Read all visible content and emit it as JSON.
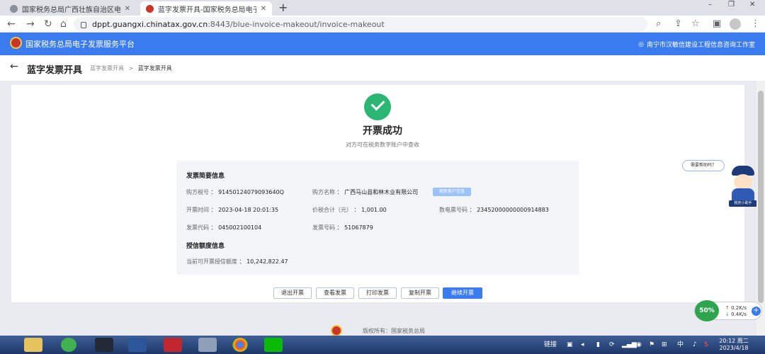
{
  "browser": {
    "tabs": [
      {
        "title": "国家税务总局广西壮族自治区电子",
        "active": false,
        "icon": "globe-icon"
      },
      {
        "title": "蓝字发票开具-国家税务总局电子",
        "active": true,
        "icon": "tax-emblem-icon"
      }
    ],
    "new_tab_symbol": "+",
    "window_controls": [
      "–",
      "❐",
      "✕"
    ],
    "url_host": "dppt.guangxi.chinatax.gov.cn",
    "url_rest": ":8443/blue-invoice-makeout/invoice-makeout"
  },
  "site": {
    "title": "国家税务总局电子发票服务平台",
    "user": "南宁市汉敏信建设工程信息咨询工作室",
    "brand_color": "#3a7bf0"
  },
  "page": {
    "title": "蓝字发票开具",
    "breadcrumb": [
      "蓝字发票开具",
      "蓝字发票开具"
    ],
    "breadcrumb_sep": ">"
  },
  "result": {
    "title": "开票成功",
    "subtitle": "对方可在税务数字账户中查收",
    "status_color": "#2bb673"
  },
  "summary": {
    "heading": "发票简要信息",
    "buyer_tax_no_label": "购方税号",
    "buyer_tax_no": "91450124079093640Q",
    "buyer_name_label": "购方名称",
    "buyer_name": "广西马山县和林木业有限公司",
    "buyer_tag": "更新客户信息",
    "issue_time_label": "开票时间",
    "issue_time": "2023-04-18 20:01:35",
    "total_label": "价税合计（元）",
    "total": "1,001.00",
    "einvoice_no_label": "数电票号码",
    "einvoice_no": "23452000000000914883",
    "invoice_code_label": "发票代码",
    "invoice_code": "045002100104",
    "invoice_no_label": "发票号码",
    "invoice_no": "51067879"
  },
  "credit": {
    "heading": "授信额度信息",
    "label": "当前可开票授信额度",
    "value": "10,242,822.47"
  },
  "actions": [
    "退出开票",
    "查看发票",
    "打印发票",
    "复制开票",
    "继续开票"
  ],
  "helper": {
    "bubble": "需要帮助吗？",
    "mascot_label": "税务小助手"
  },
  "footer": {
    "copyright": "版权所有：国家税务总局"
  },
  "speed": {
    "percent": "50%",
    "up": "0.2K/s",
    "down": "0.4K/s"
  },
  "taskbar": {
    "tray_label": "链接",
    "clock_time": "20:12 周二",
    "clock_date": "2023/4/18",
    "ime": "中"
  }
}
